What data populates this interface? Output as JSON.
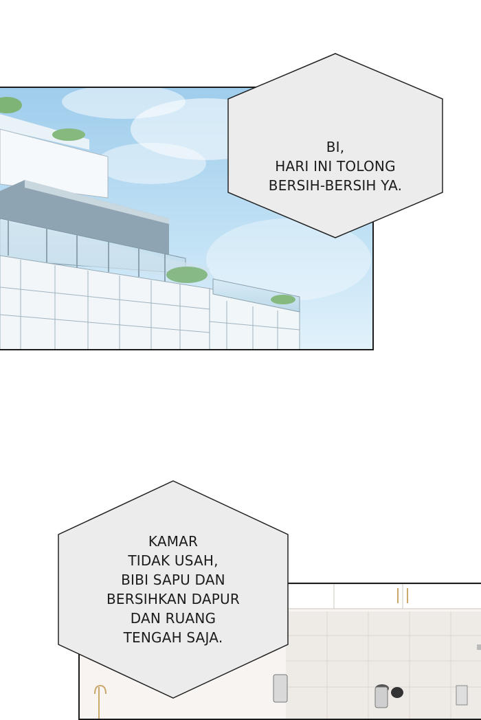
{
  "speech_bubbles": [
    {
      "lines": [
        "BI,",
        "HARI INI TOLONG",
        "BERSIH-BERSIH YA."
      ]
    },
    {
      "lines": [
        "KAMAR",
        "TIDAK USAH,",
        "BIBI SAPU DAN",
        "BERSIHKAN DAPUR",
        "DAN RUANG",
        "TENGAH SAJA."
      ]
    }
  ],
  "colors": {
    "sky_top": "#a9d4ee",
    "sky_bottom": "#d9eef9",
    "bubble_fill": "#ececec",
    "bubble_stroke": "#222222",
    "panel_border": "#1a1a1a"
  }
}
